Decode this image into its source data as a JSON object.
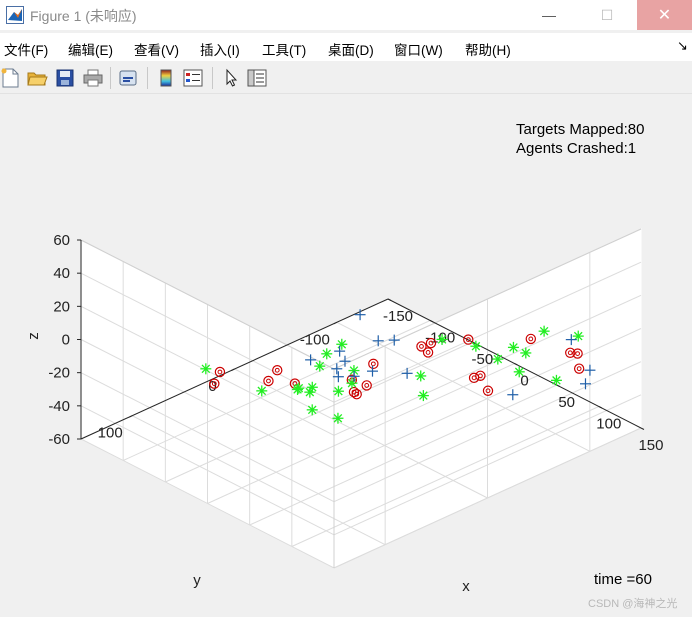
{
  "window": {
    "title": "Figure 1 (未响应)",
    "min_glyph": "—",
    "max_glyph": "☐",
    "close_glyph": "✕"
  },
  "menu": {
    "items": [
      "文件(F)",
      "编辑(E)",
      "查看(V)",
      "插入(I)",
      "工具(T)",
      "桌面(D)",
      "窗口(W)",
      "帮助(H)"
    ],
    "overflow_glyph": "↘"
  },
  "toolbar": {
    "icons": [
      "new-figure-icon",
      "open-folder-icon",
      "save-icon",
      "print-icon",
      "link-icon",
      "colorbar-icon",
      "legend-icon",
      "pointer-icon",
      "property-editor-icon"
    ]
  },
  "annotations": {
    "targets_mapped": "Targets Mapped:80",
    "agents_crashed": "Agents Crashed:1",
    "time": "time =60",
    "watermark": "CSDN @海神之光"
  },
  "colors": {
    "targets": "#cc0000",
    "agents": "#22ee22",
    "plus": "#1f5fa8"
  },
  "chart_data": {
    "type": "scatter",
    "title": "",
    "xlabel": "x",
    "ylabel": "y",
    "zlabel": "z",
    "xlim": [
      -150,
      150
    ],
    "ylim": [
      -150,
      150
    ],
    "zlim": [
      -60,
      60
    ],
    "x_ticks": [
      -150,
      -100,
      -50,
      0,
      50,
      100,
      150
    ],
    "y_ticks": [
      -100,
      0,
      100
    ],
    "z_ticks": [
      -60,
      -40,
      -20,
      0,
      20,
      40,
      60
    ],
    "x_tick_labels": [
      "-150",
      "-100",
      "-50",
      "0",
      "50",
      "100",
      "150"
    ],
    "y_tick_labels": [
      "-100",
      "0",
      "100"
    ],
    "z_tick_labels": [
      "-60",
      "-40",
      "-20",
      "0",
      "20",
      "40",
      "60"
    ],
    "view": {
      "azimuth": -37.5,
      "elevation": 30
    },
    "grid": true,
    "series": [
      {
        "marker": "circle-dot",
        "color": "#cc0000",
        "points": [
          [
            -69,
            81,
            -18
          ],
          [
            -72,
            84,
            -25
          ],
          [
            -35,
            53,
            -16
          ],
          [
            -43,
            55,
            -24
          ],
          [
            -25,
            44,
            -24
          ],
          [
            -6,
            4,
            -28
          ],
          [
            -12,
            -3,
            -39
          ],
          [
            -16,
            -9,
            -43
          ],
          [
            -9,
            -13,
            -37
          ],
          [
            11,
            -3,
            -16
          ],
          [
            45,
            -22,
            -2
          ],
          [
            48,
            -26,
            -6
          ],
          [
            32,
            -42,
            -9
          ],
          [
            69,
            -48,
            1
          ],
          [
            96,
            -45,
            -22
          ],
          [
            54,
            -66,
            -31
          ],
          [
            53,
            -73,
            -32
          ],
          [
            97,
            -86,
            -2
          ],
          [
            128,
            -99,
            -6
          ],
          [
            127,
            -107,
            -9
          ],
          [
            124,
            -111,
            -20
          ]
        ]
      },
      {
        "marker": "asterisk",
        "color": "#22ee22",
        "points": [
          [
            -93,
            75,
            -24
          ],
          [
            -36,
            18,
            -50
          ],
          [
            -57,
            50,
            -35
          ],
          [
            -3,
            31,
            -4
          ],
          [
            -25,
            27,
            -31
          ],
          [
            0,
            62,
            -16
          ],
          [
            0,
            50,
            -21
          ],
          [
            23,
            41,
            -17
          ],
          [
            -18,
            -6,
            -36
          ],
          [
            -12,
            -3,
            -26
          ],
          [
            3,
            25,
            -43
          ],
          [
            32,
            -32,
            -26
          ],
          [
            23,
            -42,
            -43
          ],
          [
            50,
            -38,
            -1
          ],
          [
            61,
            -62,
            -9
          ],
          [
            87,
            -62,
            -10
          ],
          [
            85,
            -91,
            -15
          ],
          [
            76,
            -92,
            -29
          ],
          [
            97,
            -99,
            -1
          ],
          [
            112,
            -120,
            -6
          ],
          [
            91,
            -116,
            -37
          ],
          [
            57,
            -102,
            -22
          ],
          [
            10,
            27,
            4
          ],
          [
            -7,
            55,
            -19
          ],
          [
            -4,
            37,
            -10
          ]
        ]
      },
      {
        "marker": "plus",
        "color": "#1f5fa8",
        "points": [
          [
            -27,
            27,
            -15
          ],
          [
            -5,
            18,
            -22
          ],
          [
            -2,
            14,
            -13
          ],
          [
            5,
            25,
            -2
          ],
          [
            18,
            -2,
            0
          ],
          [
            11,
            -36,
            -31
          ],
          [
            20,
            -16,
            -3
          ],
          [
            -36,
            -6,
            -32
          ],
          [
            -7,
            -17,
            -29
          ],
          [
            -13,
            -4,
            -30
          ],
          [
            72,
            -89,
            -43
          ],
          [
            88,
            -133,
            -18
          ],
          [
            138,
            -110,
            -17
          ],
          [
            140,
            -104,
            -23
          ],
          [
            -12,
            -9,
            6
          ]
        ]
      }
    ]
  }
}
